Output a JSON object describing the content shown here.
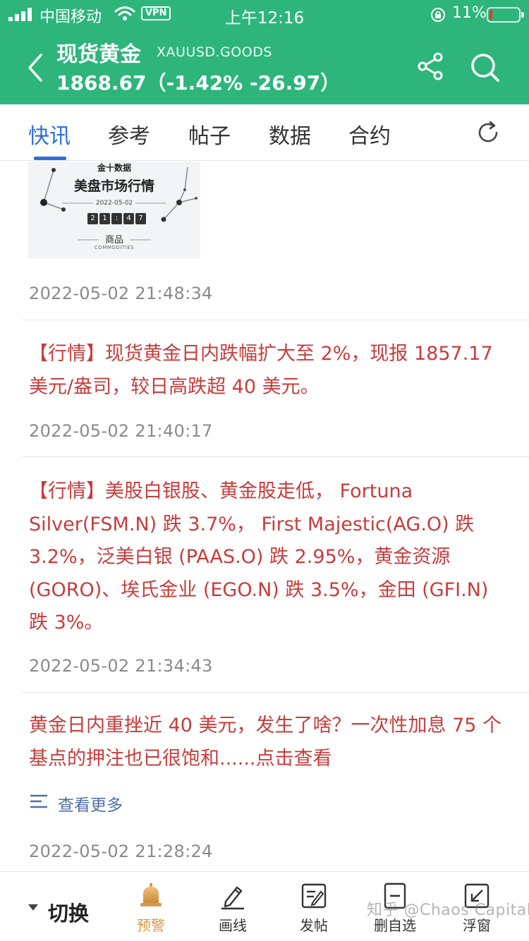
{
  "status_bar": {
    "carrier": "中国移动",
    "vpn": "VPN",
    "time": "上午12:16",
    "battery": "11%",
    "battery_level": 0.11,
    "battery_color": "#e5392f"
  },
  "header": {
    "title": "现货黄金",
    "symbol": "XAUUSD.GOODS",
    "price_line": "1868.67（-1.42% -26.97）",
    "background": "#2db57b",
    "icons": [
      "back-icon",
      "share-icon",
      "search-icon"
    ]
  },
  "tabs": {
    "items": [
      "快讯",
      "参考",
      "帖子",
      "数据",
      "合约"
    ],
    "active": "快讯",
    "accent": "#2e6fd7",
    "refresh_icon": "refresh-icon"
  },
  "feed": {
    "thumbnail": {
      "top_label": "金十数据",
      "title": "美盘市场行情",
      "date": "2022-05-02",
      "clock": [
        "2",
        "1",
        ":",
        "4",
        "7"
      ],
      "category": "商品",
      "category_en": "COMMODITIES"
    },
    "items": [
      {
        "timestamp": "2022-05-02 21:48:34"
      },
      {
        "text": "【行情】现货黄金日内跌幅扩大至 2%，现报 1857.17 美元/盎司，较日高跌超 40 美元。",
        "timestamp": "2022-05-02 21:40:17"
      },
      {
        "text": "【行情】美股白银股、黄金股走低， Fortuna Silver(FSM.N) 跌 3.7%， First Majestic(AG.O) 跌 3.2%，泛美白银 (PAAS.O) 跌 2.95%，黄金资源 (GORO)、埃氏金业 (EGO.N) 跌 3.5%，金田 (GFI.N) 跌 3%。",
        "timestamp": "2022-05-02 21:34:43"
      },
      {
        "text": "黄金日内重挫近 40 美元，发生了啥？一次性加息 75 个基点的押注也已很饱和......点击查看",
        "more_label": "查看更多",
        "timestamp": "2022-05-02 21:28:24"
      }
    ],
    "news_color": "#c73c3c"
  },
  "bottom_bar": {
    "switch_label": "切换",
    "items": [
      {
        "label": "预警",
        "icon": "bell-icon"
      },
      {
        "label": "画线",
        "icon": "pen-icon"
      },
      {
        "label": "发帖",
        "icon": "compose-icon"
      },
      {
        "label": "删自选",
        "icon": "remove-watchlist-icon"
      },
      {
        "label": "浮窗",
        "icon": "float-window-icon"
      }
    ],
    "alert_color": "#d79a45"
  },
  "watermark": "知乎 @Chaos Capital"
}
